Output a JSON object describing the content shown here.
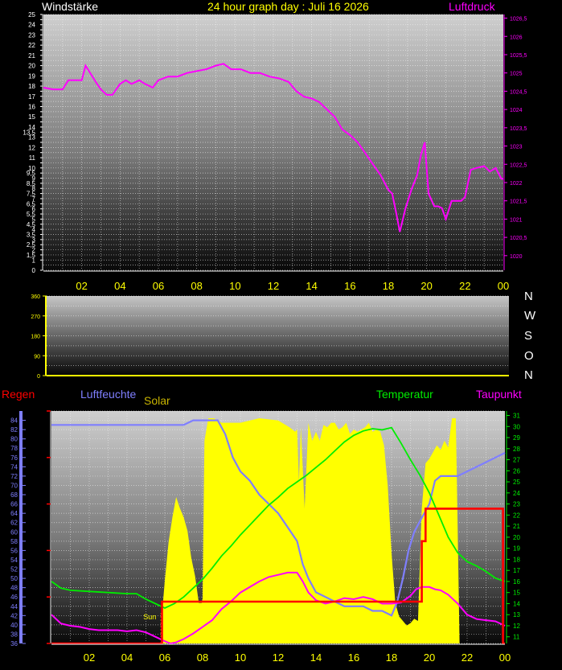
{
  "header": {
    "left_label": "Windstärke",
    "title": "24 hour graph day : Juli 16 2026",
    "right_label": "Luftdruck"
  },
  "direction_labels": [
    "N",
    "W",
    "S",
    "O",
    "N"
  ],
  "bottom_header": {
    "regen": "Regen",
    "luftfeuchte": "Luftfeuchte",
    "solar": "Solar",
    "temperatur": "Temperatur",
    "taupunkt": "Taupunkt",
    "sun_marker": "Sun"
  },
  "colors": {
    "pressure": "#ff00ff",
    "humidity": "#7f7fff",
    "temperature": "#00ee00",
    "dewpoint": "#ff00ff",
    "solar": "#ffff00",
    "rain": "#ff0000",
    "axis_text_yellow": "#ffff00"
  },
  "x_tick_labels": [
    "02",
    "04",
    "06",
    "08",
    "10",
    "12",
    "14",
    "16",
    "18",
    "20",
    "22",
    "00"
  ],
  "chart_data": [
    {
      "type": "line",
      "panel": "wind-pressure",
      "left_axis": {
        "label": "Windstärke",
        "ylim": [
          0,
          25
        ],
        "ticks": [
          "0",
          "1",
          "1,5",
          "2",
          "2,5",
          "3",
          "3,5",
          "4",
          "4,5",
          "5",
          "5,5",
          "6",
          "6,5",
          "7",
          "7,5",
          "8",
          "8,5",
          "9",
          "9,5",
          "10",
          "10,5",
          "11",
          "11,5",
          "12",
          "12,5",
          "13",
          "13,5",
          "14",
          "14,5",
          "15",
          "15,5",
          "16",
          "16,5",
          "17",
          "17,5",
          "18",
          "18,5",
          "19",
          "19,5",
          "20",
          "20,5",
          "21",
          "21,5",
          "22",
          "22,5",
          "23",
          "23,5",
          "24",
          "24,5",
          "25"
        ],
        "shown": [
          "0",
          "1",
          "1,5",
          "2",
          "2,5",
          "3",
          "3,5",
          "4",
          "4,5",
          "5",
          "5,5",
          "6",
          "6,5",
          "7",
          "7,5",
          "8",
          "8,5",
          "9",
          "9,5",
          "10",
          "11",
          "12",
          "13",
          "13,5",
          "14",
          "15",
          "16",
          "17",
          "18",
          "19",
          "20",
          "21",
          "22",
          "23",
          "24",
          "25"
        ]
      },
      "right_axis": {
        "label": "Luftdruck",
        "ylim": [
          1019.6,
          1026.6
        ],
        "ticks": [
          "1020",
          "1020,5",
          "1021",
          "1021,5",
          "1022",
          "1022,5",
          "1023",
          "1023,5",
          "1024",
          "1024,5",
          "1025",
          "1025,5",
          "1026",
          "1026,5"
        ]
      },
      "x_hours": [
        0,
        24
      ],
      "series": [
        {
          "name": "Luftdruck",
          "x": [
            0,
            0.5,
            1,
            1.3,
            1.6,
            2,
            2.2,
            2.5,
            2.8,
            3,
            3.3,
            3.6,
            4,
            4.3,
            4.6,
            5,
            5.3,
            5.7,
            6,
            6.5,
            7,
            7.5,
            8,
            8.5,
            9,
            9.4,
            9.8,
            10.3,
            10.8,
            11.3,
            11.8,
            12.3,
            12.8,
            13.2,
            13.6,
            14,
            14.4,
            14.8,
            15.2,
            15.6,
            16,
            16.4,
            16.8,
            17.2,
            17.6,
            18,
            18.2,
            18.4,
            18.6,
            18.9,
            19.2,
            19.5,
            19.7,
            19.9,
            20.1,
            20.4,
            20.6,
            20.8,
            21,
            21.3,
            21.6,
            21.8,
            22,
            22.3,
            22.6,
            23,
            23.3,
            23.6,
            23.9,
            24
          ],
          "y": [
            1024.6,
            1024.55,
            1024.55,
            1024.8,
            1024.8,
            1024.8,
            1025.2,
            1024.95,
            1024.7,
            1024.55,
            1024.4,
            1024.4,
            1024.7,
            1024.8,
            1024.7,
            1024.8,
            1024.7,
            1024.6,
            1024.8,
            1024.9,
            1024.9,
            1025,
            1025.05,
            1025.1,
            1025.2,
            1025.25,
            1025.1,
            1025.1,
            1025,
            1025,
            1024.9,
            1024.85,
            1024.75,
            1024.5,
            1024.35,
            1024.3,
            1024.2,
            1024,
            1023.8,
            1023.45,
            1023.3,
            1023.1,
            1022.8,
            1022.5,
            1022.2,
            1021.8,
            1021.7,
            1021.2,
            1020.65,
            1021.3,
            1021.8,
            1022.2,
            1022.75,
            1023.1,
            1021.7,
            1021.35,
            1021.35,
            1021.3,
            1021,
            1021.5,
            1021.5,
            1021.5,
            1021.6,
            1022.35,
            1022.4,
            1022.45,
            1022.3,
            1022.4,
            1022.1,
            1022.1
          ]
        }
      ]
    },
    {
      "type": "line",
      "panel": "wind-direction",
      "y_axis": {
        "ylim": [
          0,
          360
        ],
        "ticks": [
          "0",
          "90",
          "180",
          "270",
          "360"
        ]
      },
      "series": []
    },
    {
      "type": "area",
      "panel": "temperature-humidity-solar-rain",
      "left_axis": {
        "label": "Luftfeuchte",
        "ylim": [
          36,
          86
        ],
        "ticks": [
          "36",
          "38",
          "40",
          "42",
          "44",
          "46",
          "48",
          "50",
          "52",
          "54",
          "56",
          "58",
          "60",
          "62",
          "64",
          "66",
          "68",
          "70",
          "72",
          "74",
          "76",
          "78",
          "80",
          "82",
          "84"
        ]
      },
      "right_axis": {
        "label": "Temperatur",
        "ylim": [
          10.4,
          31.4
        ],
        "ticks": [
          "11",
          "12",
          "13",
          "14",
          "15",
          "16",
          "17",
          "18",
          "19",
          "20",
          "21",
          "22",
          "23",
          "24",
          "25",
          "26",
          "27",
          "28",
          "29",
          "30",
          "31"
        ]
      },
      "series": [
        {
          "name": "Solar",
          "x": [
            0,
            5.8,
            5.85,
            6.0,
            6.2,
            6.4,
            6.6,
            6.8,
            7.0,
            7.2,
            7.4,
            7.6,
            7.8,
            7.95,
            8.0,
            8.1,
            8.3,
            8.6,
            9,
            10,
            11,
            12,
            12.6,
            12.9,
            13.0,
            13.1,
            13.2,
            13.4,
            13.6,
            13.8,
            14.0,
            14.2,
            14.4,
            14.6,
            14.8,
            15,
            15.2,
            15.4,
            15.6,
            15.8,
            16,
            16.2,
            16.4,
            16.6,
            16.8,
            17,
            17.2,
            17.4,
            17.6,
            17.8,
            18.0,
            18.2,
            18.4,
            18.6,
            18.8,
            19.0,
            19.2,
            19.4,
            19.6,
            19.8,
            20,
            20.2,
            20.4,
            20.6,
            20.8,
            21,
            21.2,
            21.4,
            21.5,
            21.6,
            24
          ],
          "y": [
            0,
            0,
            130,
            280,
            450,
            560,
            650,
            600,
            560,
            500,
            380,
            300,
            180,
            180,
            200,
            900,
            1000,
            1000,
            980,
            980,
            1000,
            990,
            960,
            940,
            950,
            720,
            960,
            600,
            980,
            900,
            940,
            900,
            970,
            960,
            980,
            980,
            950,
            960,
            980,
            930,
            950,
            940,
            950,
            960,
            980,
            940,
            950,
            940,
            880,
            700,
            400,
            180,
            120,
            100,
            80,
            90,
            110,
            100,
            600,
            800,
            820,
            850,
            880,
            860,
            900,
            870,
            1000,
            1000,
            500,
            0,
            0
          ]
        },
        {
          "name": "Luftfeuchte",
          "x": [
            0,
            1,
            2,
            3,
            4,
            5,
            6,
            7,
            7.5,
            8,
            8.4,
            8.8,
            9.2,
            9.6,
            10,
            10.5,
            11,
            11.5,
            12,
            12.5,
            13,
            13.3,
            13.6,
            14,
            14.5,
            15,
            15.5,
            16,
            16.5,
            17,
            17.5,
            18,
            18.3,
            18.6,
            18.9,
            19.2,
            19.6,
            20,
            20.3,
            20.6,
            21,
            21.5,
            22,
            22.5,
            23,
            23.5,
            24
          ],
          "y": [
            83,
            83,
            83,
            83,
            83,
            83,
            83,
            83,
            84,
            84,
            84,
            84,
            81,
            76,
            73,
            71,
            68,
            66,
            64,
            61,
            58,
            53,
            50,
            47,
            46,
            45,
            44,
            44,
            44,
            43,
            43,
            42,
            45,
            50,
            56,
            60,
            63,
            66,
            71,
            72,
            72,
            72,
            73,
            74,
            75,
            76,
            77
          ]
        },
        {
          "name": "Temperatur",
          "x": [
            0,
            0.5,
            1,
            2,
            3,
            4,
            4.5,
            5,
            5.5,
            6,
            6.5,
            7,
            7.5,
            8,
            8.5,
            9,
            9.5,
            10,
            10.5,
            11,
            11.5,
            12,
            12.5,
            13,
            13.5,
            14,
            14.5,
            15,
            15.5,
            16,
            16.5,
            17,
            17.5,
            18,
            18.5,
            19,
            19.5,
            20,
            20.5,
            21,
            21.5,
            22,
            22.5,
            23,
            23.5,
            24
          ],
          "y": [
            16,
            15.4,
            15.2,
            15.1,
            15.0,
            14.9,
            14.9,
            14.4,
            14.0,
            13.6,
            14.0,
            14.6,
            15.4,
            16.2,
            17.2,
            18.3,
            19.2,
            20.2,
            21.1,
            22.0,
            22.9,
            23.6,
            24.4,
            25.0,
            25.6,
            26.3,
            27.0,
            27.8,
            28.6,
            29.2,
            29.6,
            29.8,
            29.7,
            29.9,
            28.5,
            27.0,
            25.6,
            24.0,
            22.0,
            20.0,
            18.6,
            17.8,
            17.4,
            16.9,
            16.3,
            16.0
          ]
        },
        {
          "name": "Taupunkt",
          "x": [
            0,
            0.5,
            1,
            1.5,
            2,
            2.5,
            3,
            3.5,
            4,
            4.5,
            5,
            5.5,
            6,
            6.3,
            6.6,
            7,
            7.5,
            8,
            8.5,
            9,
            9.5,
            10,
            10.5,
            11,
            11.5,
            12,
            12.5,
            13,
            13.3,
            13.6,
            14,
            14.5,
            15,
            15.5,
            16,
            16.5,
            17,
            17.5,
            18,
            18.5,
            19,
            19.3,
            19.6,
            20,
            20.3,
            20.6,
            21,
            21.5,
            22,
            22.5,
            23,
            23.5,
            24
          ],
          "y": [
            13,
            12.2,
            12,
            11.9,
            11.7,
            11.6,
            11.6,
            11.6,
            11.5,
            11.6,
            11.4,
            11.0,
            10.6,
            10.4,
            10.5,
            10.8,
            11.3,
            11.9,
            12.5,
            13.5,
            14.2,
            15.0,
            15.5,
            16.0,
            16.4,
            16.6,
            16.8,
            16.8,
            16.0,
            15.0,
            14.3,
            14.0,
            14.2,
            14.5,
            14.4,
            14.6,
            14.4,
            14.0,
            14.0,
            14.1,
            14.7,
            15.3,
            15.5,
            15.5,
            15.3,
            15.2,
            14.8,
            14.0,
            13.0,
            12.6,
            12.5,
            12.4,
            12.0
          ]
        },
        {
          "name": "Regen",
          "x": [
            0,
            5.85,
            5.85,
            19.6,
            19.6,
            19.8,
            19.8,
            23.9,
            23.9,
            24
          ],
          "y": [
            0,
            0,
            0.9,
            0.9,
            2.2,
            2.2,
            2.9,
            2.9,
            0,
            0
          ]
        }
      ]
    }
  ]
}
